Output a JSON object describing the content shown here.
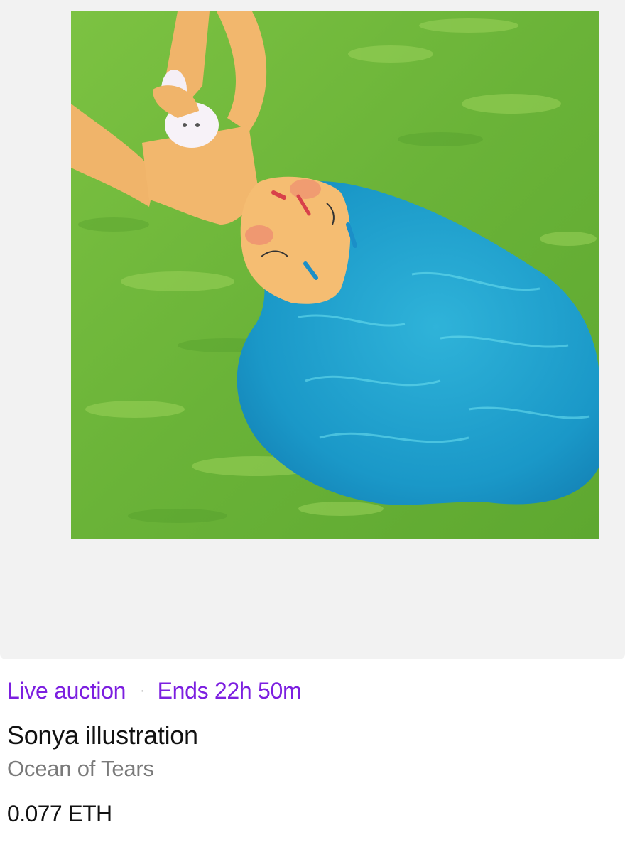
{
  "card": {
    "status": "Live auction",
    "separator": "·",
    "ends": "Ends 22h 50m",
    "artist": "Sonya illustration",
    "title": "Ocean of Tears",
    "price": "0.077 ETH"
  },
  "colors": {
    "accent": "#7c1fe0",
    "muted": "#7a7a7a",
    "frame": "#f2f2f2",
    "grass": "#6fb63a",
    "hair": "#1a9fcf",
    "skin": "#f0b46a"
  }
}
